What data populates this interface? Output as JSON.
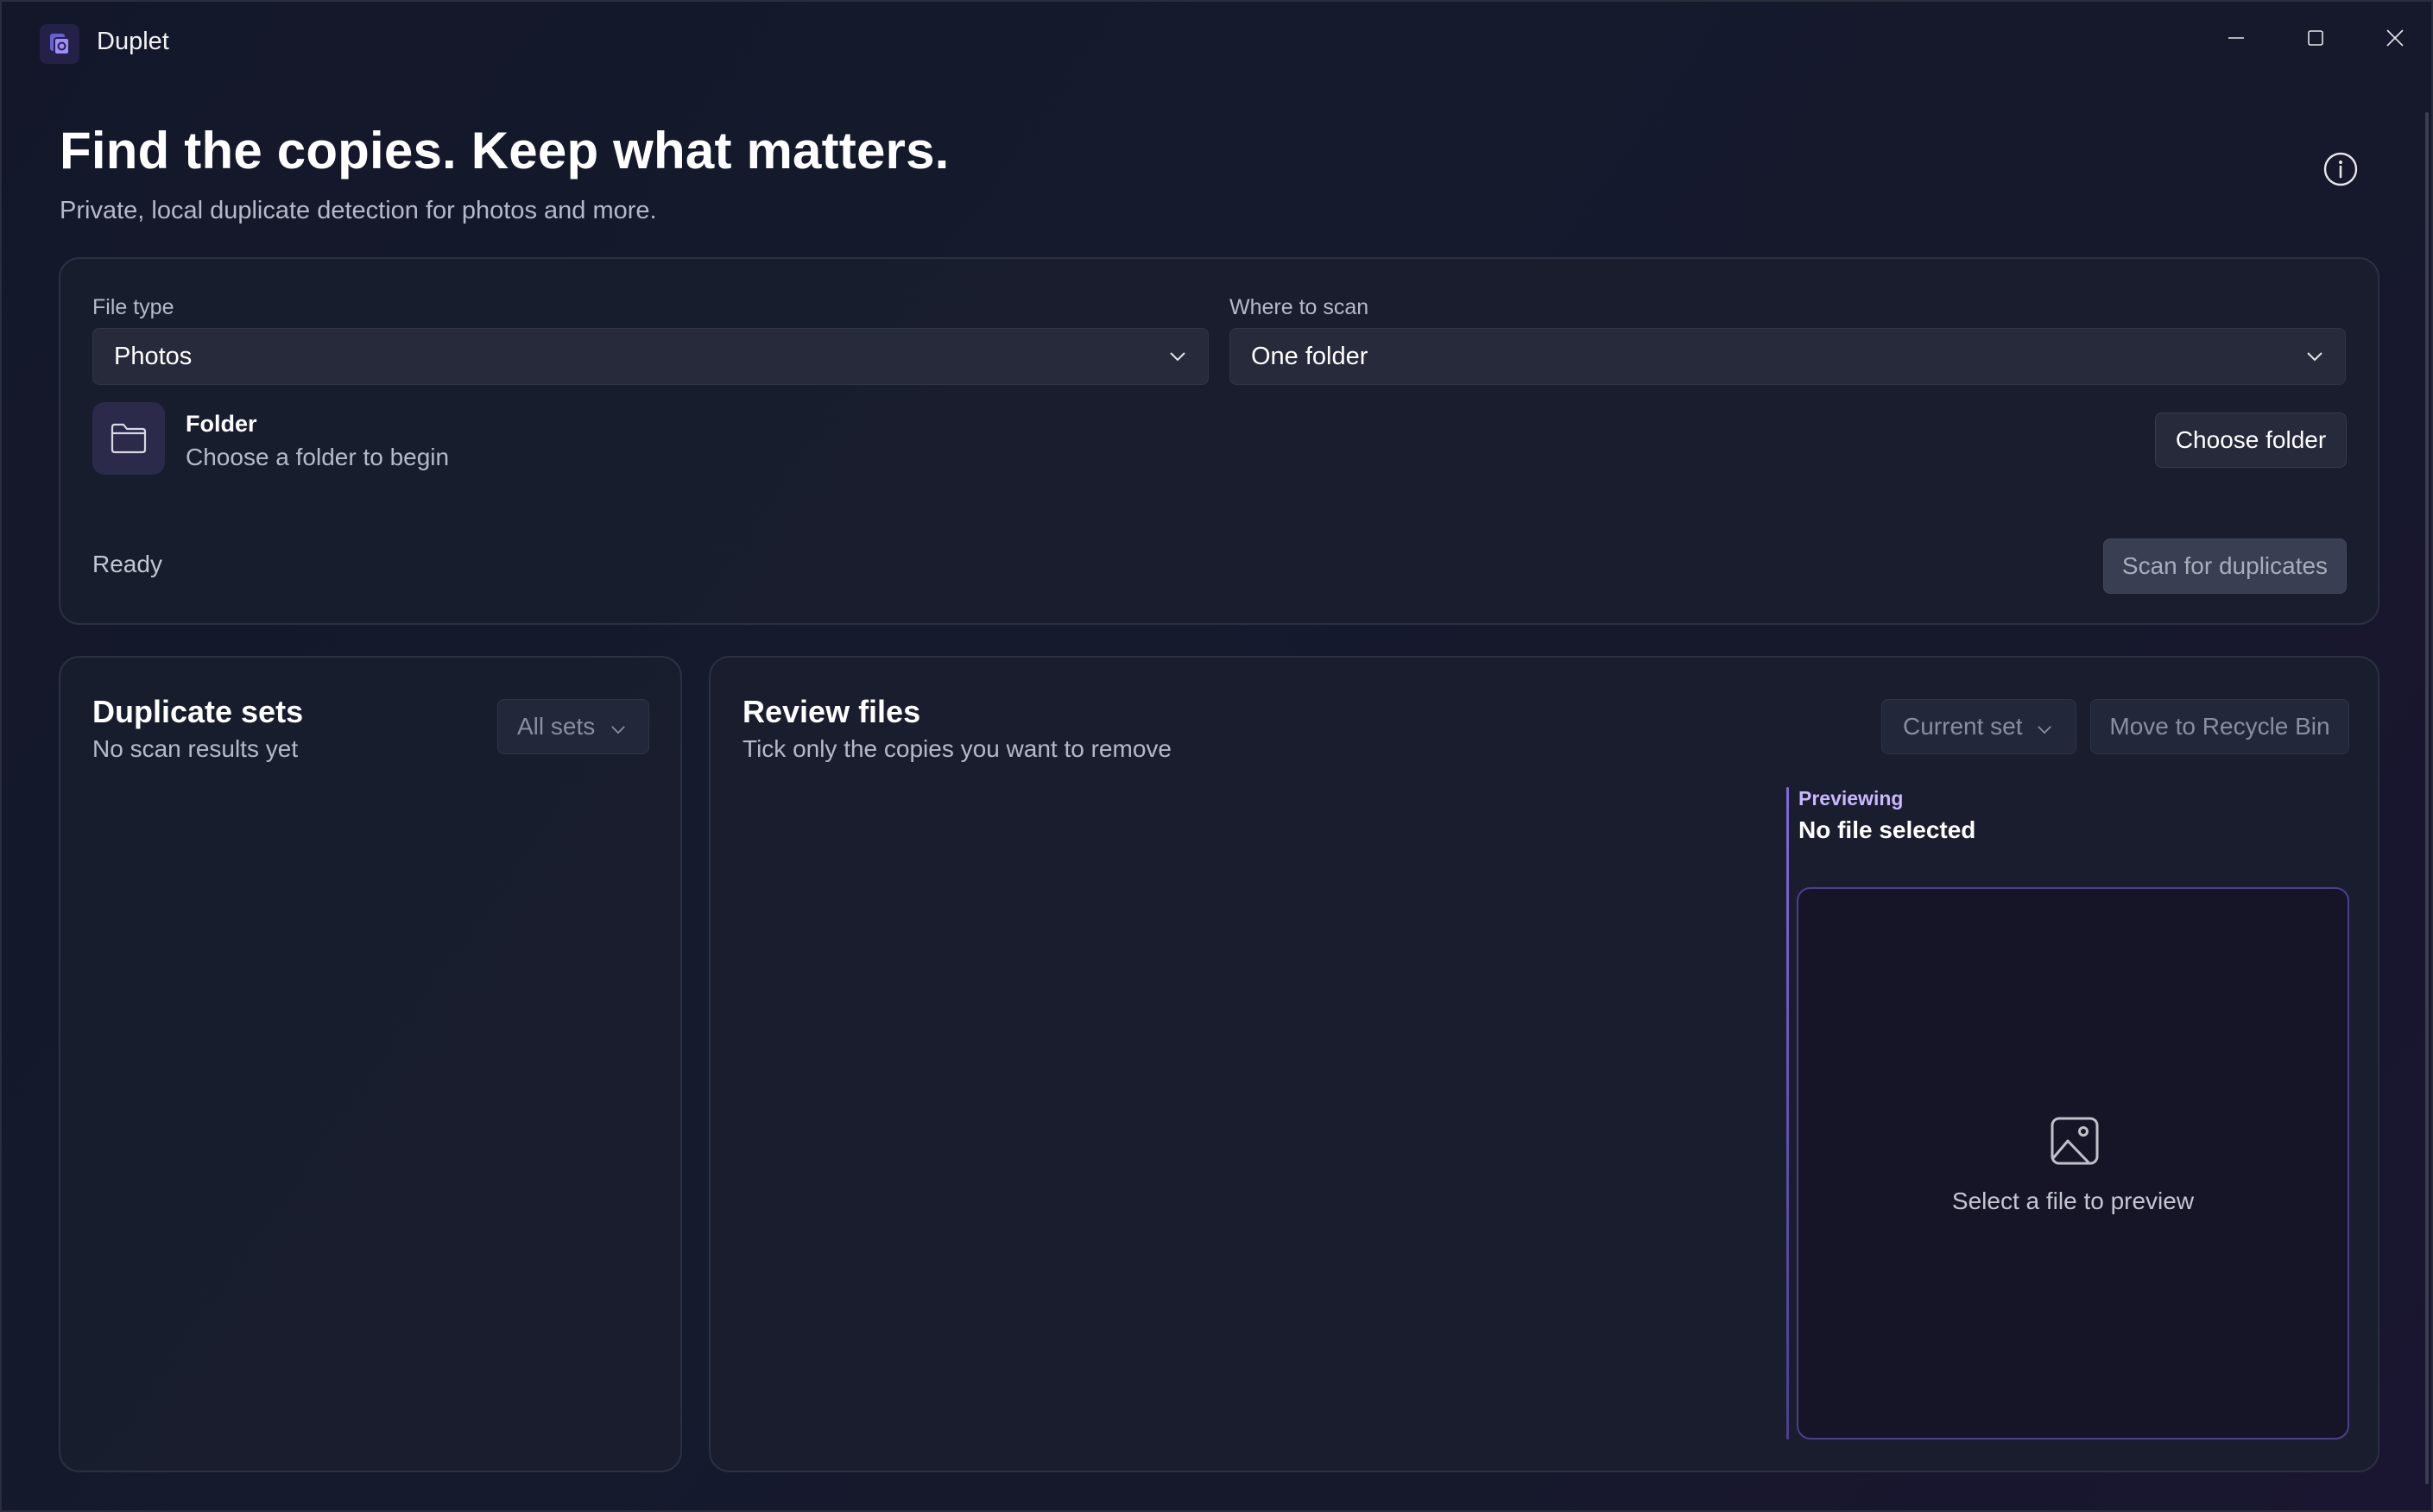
{
  "window": {
    "title": "Duplet",
    "controls": {
      "minimize": "minimize",
      "maximize": "maximize",
      "close": "close"
    }
  },
  "header": {
    "title": "Find the copies. Keep what matters.",
    "subtitle": "Private, local duplicate detection for photos and more."
  },
  "scan": {
    "file_type": {
      "label": "File type",
      "value": "Photos"
    },
    "where": {
      "label": "Where to scan",
      "value": "One folder"
    },
    "folder": {
      "title": "Folder",
      "subtitle": "Choose a folder to begin"
    },
    "choose_button": "Choose folder",
    "status": "Ready",
    "scan_button": "Scan for duplicates"
  },
  "sets": {
    "title": "Duplicate sets",
    "subtitle": "No scan results yet",
    "filter": "All sets"
  },
  "review": {
    "title": "Review files",
    "subtitle": "Tick only the copies you want to remove",
    "scope": "Current set",
    "recycle_button": "Move to Recycle Bin",
    "preview": {
      "label": "Previewing",
      "file": "No file selected",
      "hint": "Select a file to preview"
    }
  },
  "icons": {
    "app": "duplet-logo-icon",
    "info": "info-icon",
    "folder": "folder-icon",
    "chevron": "chevron-down-icon",
    "image": "image-icon"
  },
  "colors": {
    "accent": "#7f6bd6",
    "accent_text": "#c9b8ff",
    "card": "#1a1e2f",
    "background": "#131729"
  }
}
